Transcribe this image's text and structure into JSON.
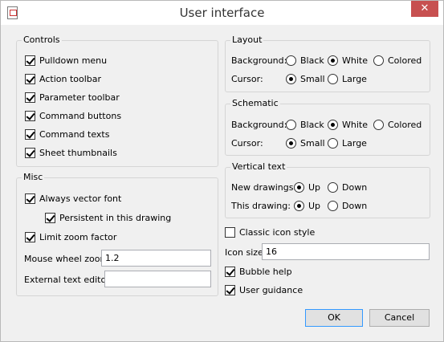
{
  "window": {
    "title": "User interface",
    "close_glyph": "✕"
  },
  "controls": {
    "legend": "Controls",
    "items": [
      {
        "label": "Pulldown menu",
        "checked": true
      },
      {
        "label": "Action toolbar",
        "checked": true
      },
      {
        "label": "Parameter toolbar",
        "checked": true
      },
      {
        "label": "Command buttons",
        "checked": true
      },
      {
        "label": "Command texts",
        "checked": true
      },
      {
        "label": "Sheet thumbnails",
        "checked": true
      }
    ]
  },
  "misc": {
    "legend": "Misc",
    "always_vector_font": "Always vector font",
    "persistent": "Persistent in this drawing",
    "limit_zoom": "Limit zoom factor",
    "mouse_wheel_label": "Mouse wheel zoom",
    "mouse_wheel_value": "1.2",
    "ext_editor_label": "External text editor",
    "ext_editor_value": ""
  },
  "layout": {
    "legend": "Layout",
    "background_label": "Background:",
    "cursor_label": "Cursor:",
    "black": "Black",
    "white": "White",
    "colored": "Colored",
    "small": "Small",
    "large": "Large"
  },
  "schematic": {
    "legend": "Schematic",
    "background_label": "Background:",
    "cursor_label": "Cursor:",
    "black": "Black",
    "white": "White",
    "colored": "Colored",
    "small": "Small",
    "large": "Large"
  },
  "vertical": {
    "legend": "Vertical text",
    "new_label": "New drawings:",
    "this_label": "This drawing:",
    "up": "Up",
    "down": "Down"
  },
  "classic_icon_style": "Classic icon style",
  "icon_size_label": "Icon size",
  "icon_size_value": "16",
  "bubble_help": "Bubble help",
  "user_guidance": "User guidance",
  "buttons": {
    "ok": "OK",
    "cancel": "Cancel"
  }
}
